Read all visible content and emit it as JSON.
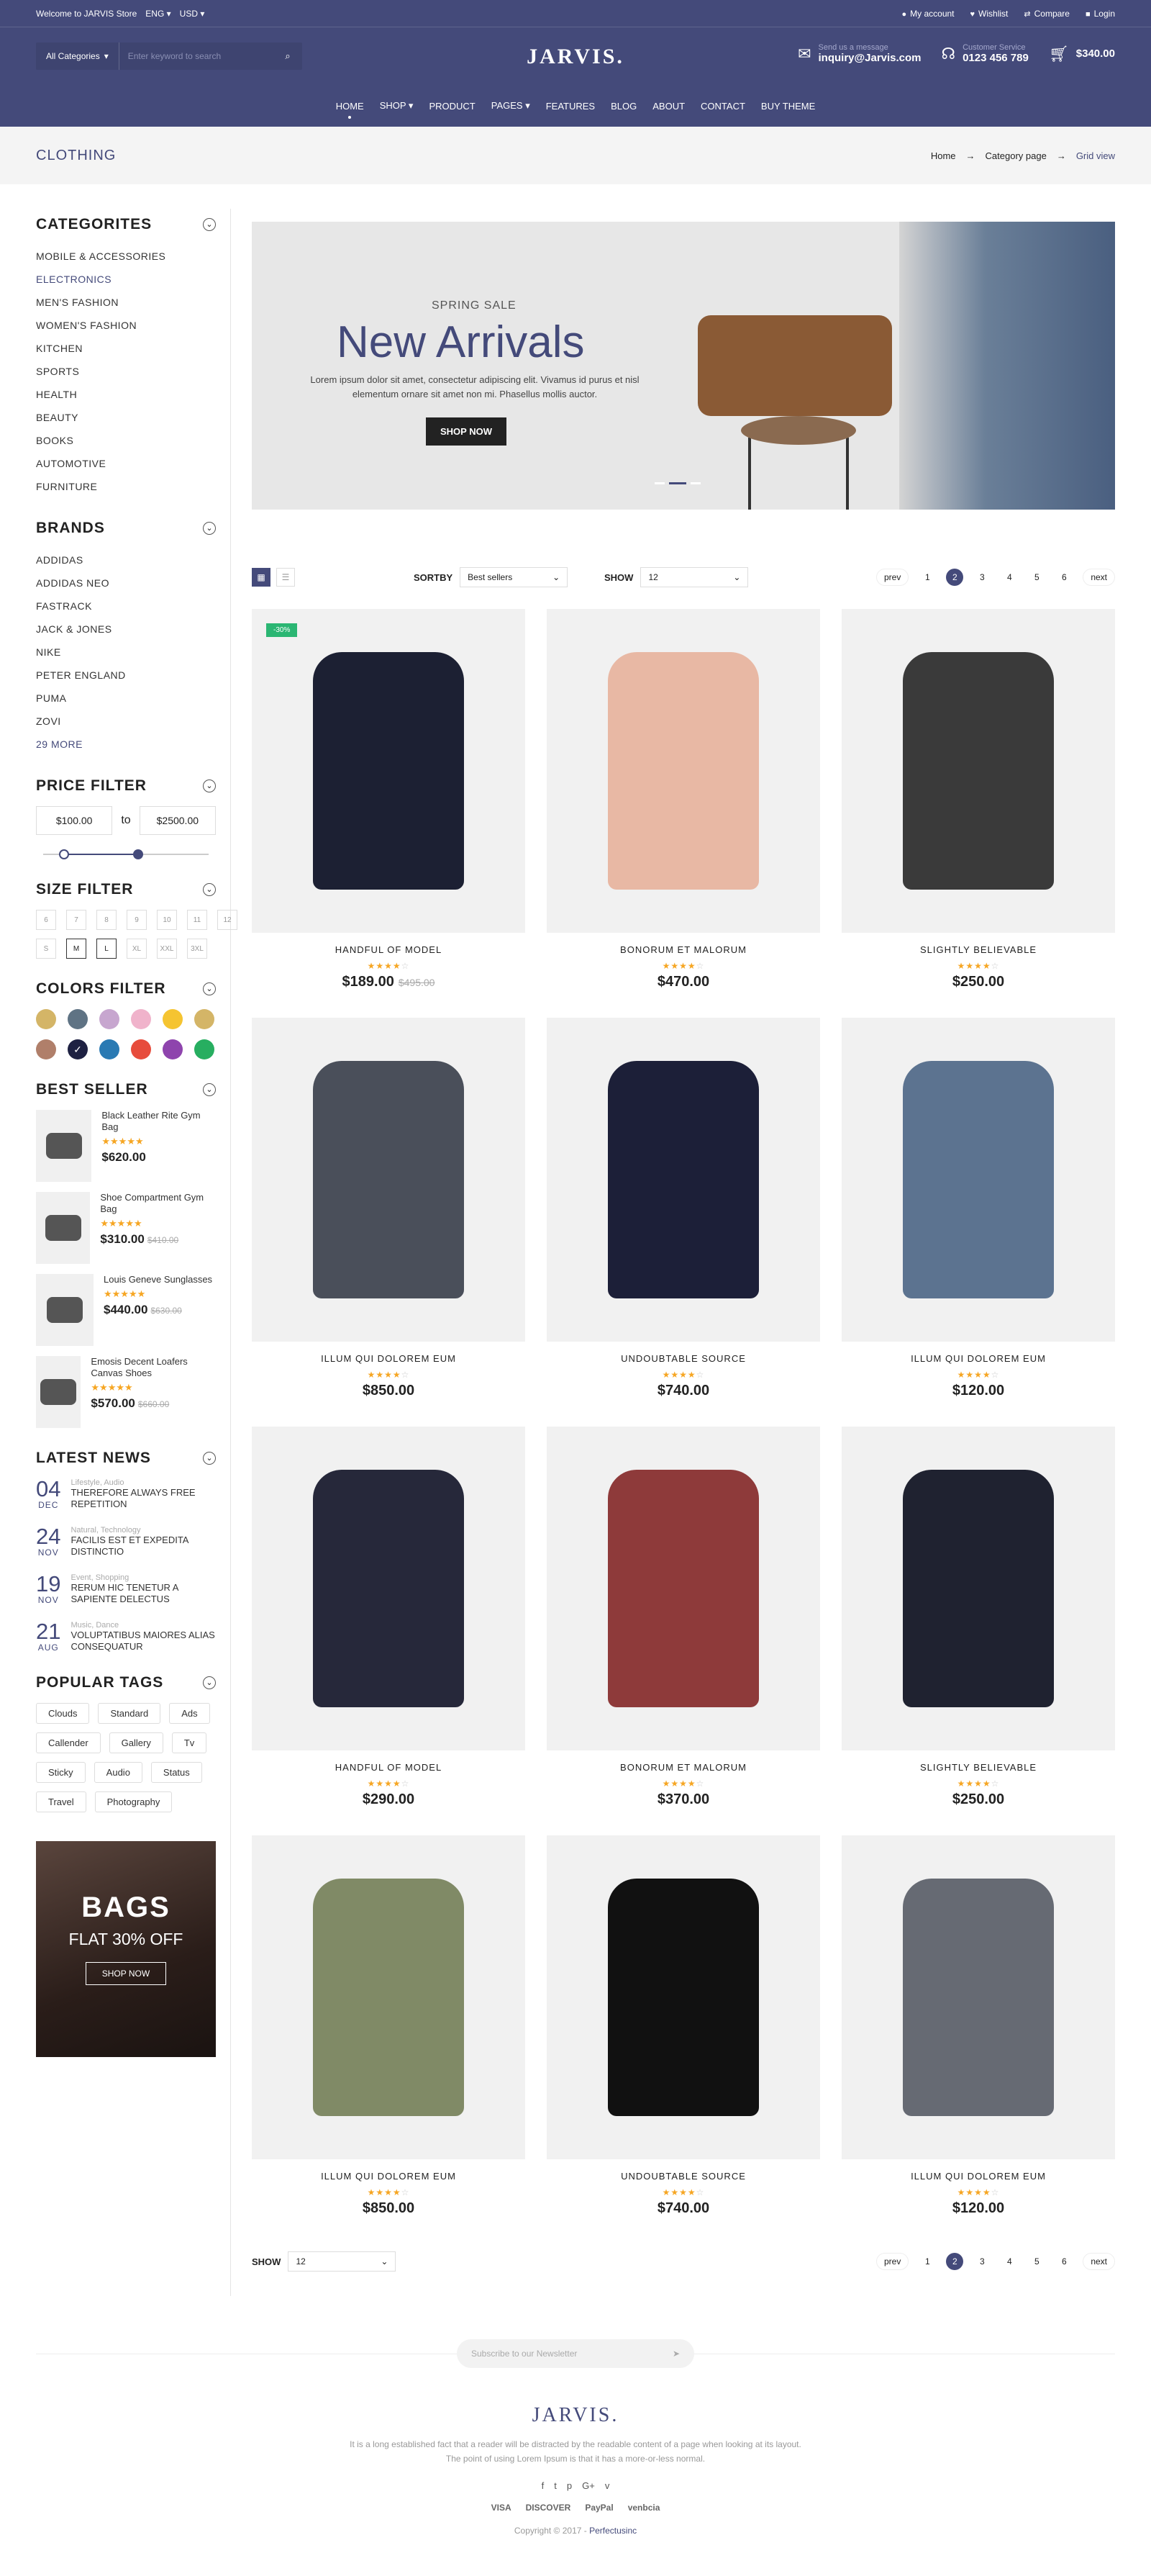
{
  "topbar": {
    "welcome": "Welcome to JARVIS Store",
    "lang": "ENG",
    "currency": "USD",
    "links": [
      "My account",
      "Wishlist",
      "Compare",
      "Login"
    ]
  },
  "header": {
    "category": "All Categories",
    "search_placeholder": "Enter keyword to search",
    "logo": "JARVIS.",
    "email_label": "Send us a message",
    "email": "inquiry@Jarvis.com",
    "phone_label": "Customer Service",
    "phone": "0123 456 789",
    "cart_total": "$340.00"
  },
  "nav": [
    "HOME",
    "SHOP",
    "PRODUCT",
    "PAGES",
    "FEATURES",
    "BLOG",
    "ABOUT",
    "CONTACT",
    "BUY THEME"
  ],
  "crumbbar": {
    "title": "CLOTHING",
    "crumbs": [
      "Home",
      "Category page",
      "Grid view"
    ]
  },
  "sidebar": {
    "categories_title": "CATEGORITES",
    "categories": [
      "MOBILE & ACCESSORIES",
      "ELECTRONICS",
      "MEN'S FASHION",
      "WOMEN'S FASHION",
      "KITCHEN",
      "SPORTS",
      "HEALTH",
      "BEAUTY",
      "BOOKS",
      "AUTOMOTIVE",
      "FURNITURE"
    ],
    "brands_title": "BRANDS",
    "brands": [
      "ADDIDAS",
      "ADDIDAS NEO",
      "FASTRACK",
      "JACK & JONES",
      "NIKE",
      "PETER ENGLAND",
      "PUMA",
      "ZOVI"
    ],
    "brands_more": "29 MORE",
    "price_title": "PRICE FILTER",
    "price_min": "$100.00",
    "price_to": "to",
    "price_max": "$2500.00",
    "size_title": "SIZE FILTER",
    "sizes": [
      "6",
      "7",
      "8",
      "9",
      "10",
      "11",
      "12",
      "S",
      "M",
      "L",
      "XL",
      "XXL",
      "3XL"
    ],
    "colors_title": "COLORS FILTER",
    "colors": [
      "#d4b567",
      "#5f7384",
      "#c7a6cf",
      "#f0b3cb",
      "#f5c431",
      "#d4b567",
      "#b07f6a",
      "#1e2142",
      "#2a7ab3",
      "#e74c3c",
      "#8e44ad",
      "#27ae60"
    ],
    "best_title": "BEST SELLER",
    "best": [
      {
        "name": "Black Leather Rite Gym Bag",
        "stars": "★★★★★",
        "price": "$620.00",
        "old": ""
      },
      {
        "name": "Shoe Compartment Gym Bag",
        "stars": "★★★★★",
        "price": "$310.00",
        "old": "$410.00"
      },
      {
        "name": "Louis Geneve Sunglasses",
        "stars": "★★★★★",
        "price": "$440.00",
        "old": "$630.00"
      },
      {
        "name": "Emosis Decent Loafers Canvas Shoes",
        "stars": "★★★★★",
        "price": "$570.00",
        "old": "$660.00"
      }
    ],
    "news_title": "LATEST NEWS",
    "news": [
      {
        "day": "04",
        "mon": "DEC",
        "cat": "Lifestyle, Audio",
        "title": "THEREFORE ALWAYS FREE REPETITION"
      },
      {
        "day": "24",
        "mon": "NOV",
        "cat": "Natural, Technology",
        "title": "FACILIS EST ET EXPEDITA DISTINCTIO"
      },
      {
        "day": "19",
        "mon": "NOV",
        "cat": "Event, Shopping",
        "title": "RERUM HIC TENETUR A SAPIENTE DELECTUS"
      },
      {
        "day": "21",
        "mon": "AUG",
        "cat": "Music, Dance",
        "title": "VOLUPTATIBUS MAIORES ALIAS CONSEQUATUR"
      }
    ],
    "tags_title": "POPULAR TAGS",
    "tags": [
      "Clouds",
      "Standard",
      "Ads",
      "Callender",
      "Gallery",
      "Tv",
      "Sticky",
      "Audio",
      "Status",
      "Travel",
      "Photography"
    ],
    "banner": {
      "title": "BAGS",
      "sub": "FLAT 30% OFF",
      "btn": "SHOP NOW"
    }
  },
  "hero": {
    "sub": "SPRING SALE",
    "title": "New Arrivals",
    "desc": "Lorem ipsum dolor sit amet, consectetur adipiscing elit. Vivamus id purus et nisl elementum ornare sit amet non mi. Phasellus mollis auctor.",
    "btn": "SHOP NOW"
  },
  "toolbar": {
    "sortby_label": "SORTBY",
    "sortby_value": "Best sellers",
    "show_label": "SHOW",
    "show_value": "12",
    "prev": "prev",
    "next": "next",
    "pages": [
      "1",
      "2",
      "3",
      "4",
      "5",
      "6"
    ]
  },
  "products": [
    {
      "name": "HANDFUL OF MODEL",
      "stars": "★★★★",
      "empty": "☆",
      "price": "$189.00",
      "old": "$495.00",
      "badge": "-30%",
      "color": "#1c2033"
    },
    {
      "name": "BONORUM ET MALORUM",
      "stars": "★★★★",
      "empty": "☆",
      "price": "$470.00",
      "old": "",
      "badge": "",
      "color": "#e8b8a4"
    },
    {
      "name": "SLIGHTLY BELIEVABLE",
      "stars": "★★★★",
      "empty": "☆",
      "price": "$250.00",
      "old": "",
      "badge": "",
      "color": "#3a3a3a"
    },
    {
      "name": "ILLUM QUI DOLOREM EUM",
      "stars": "★★★★",
      "empty": "☆",
      "price": "$850.00",
      "old": "",
      "badge": "",
      "color": "#4a4f5a"
    },
    {
      "name": "UNDOUBTABLE SOURCE",
      "stars": "★★★★",
      "empty": "☆",
      "price": "$740.00",
      "old": "",
      "badge": "",
      "color": "#1c1f38"
    },
    {
      "name": "ILLUM QUI DOLOREM EUM",
      "stars": "★★★★",
      "empty": "☆",
      "price": "$120.00",
      "old": "",
      "badge": "",
      "color": "#5c7390"
    },
    {
      "name": "HANDFUL OF MODEL",
      "stars": "★★★★",
      "empty": "☆",
      "price": "$290.00",
      "old": "",
      "badge": "",
      "color": "#26283a"
    },
    {
      "name": "BONORUM ET MALORUM",
      "stars": "★★★★",
      "empty": "☆",
      "price": "$370.00",
      "old": "",
      "badge": "",
      "color": "#8e3a3a"
    },
    {
      "name": "SLIGHTLY BELIEVABLE",
      "stars": "★★★★",
      "empty": "☆",
      "price": "$250.00",
      "old": "",
      "badge": "",
      "color": "#1f2230"
    },
    {
      "name": "ILLUM QUI DOLOREM EUM",
      "stars": "★★★★",
      "empty": "☆",
      "price": "$850.00",
      "old": "",
      "badge": "",
      "color": "#808a66"
    },
    {
      "name": "UNDOUBTABLE SOURCE",
      "stars": "★★★★",
      "empty": "☆",
      "price": "$740.00",
      "old": "",
      "badge": "",
      "color": "#111111"
    },
    {
      "name": "ILLUM QUI DOLOREM EUM",
      "stars": "★★★★",
      "empty": "☆",
      "price": "$120.00",
      "old": "",
      "badge": "",
      "color": "#666a73"
    }
  ],
  "footer": {
    "newsletter_placeholder": "Subscribe to our Newsletter",
    "logo": "JARVIS.",
    "text": "It is a long established fact that a reader will be distracted by the readable content of a page when looking at its layout. The point of using Lorem Ipsum is that it has a more-or-less normal.",
    "social": [
      "f",
      "t",
      "p",
      "G+",
      "v"
    ],
    "payments": [
      "VISA",
      "DISCOVER",
      "PayPal",
      "venbcia"
    ],
    "copy": "Copyright © 2017 -",
    "copy_brand": "Perfectusinc"
  }
}
